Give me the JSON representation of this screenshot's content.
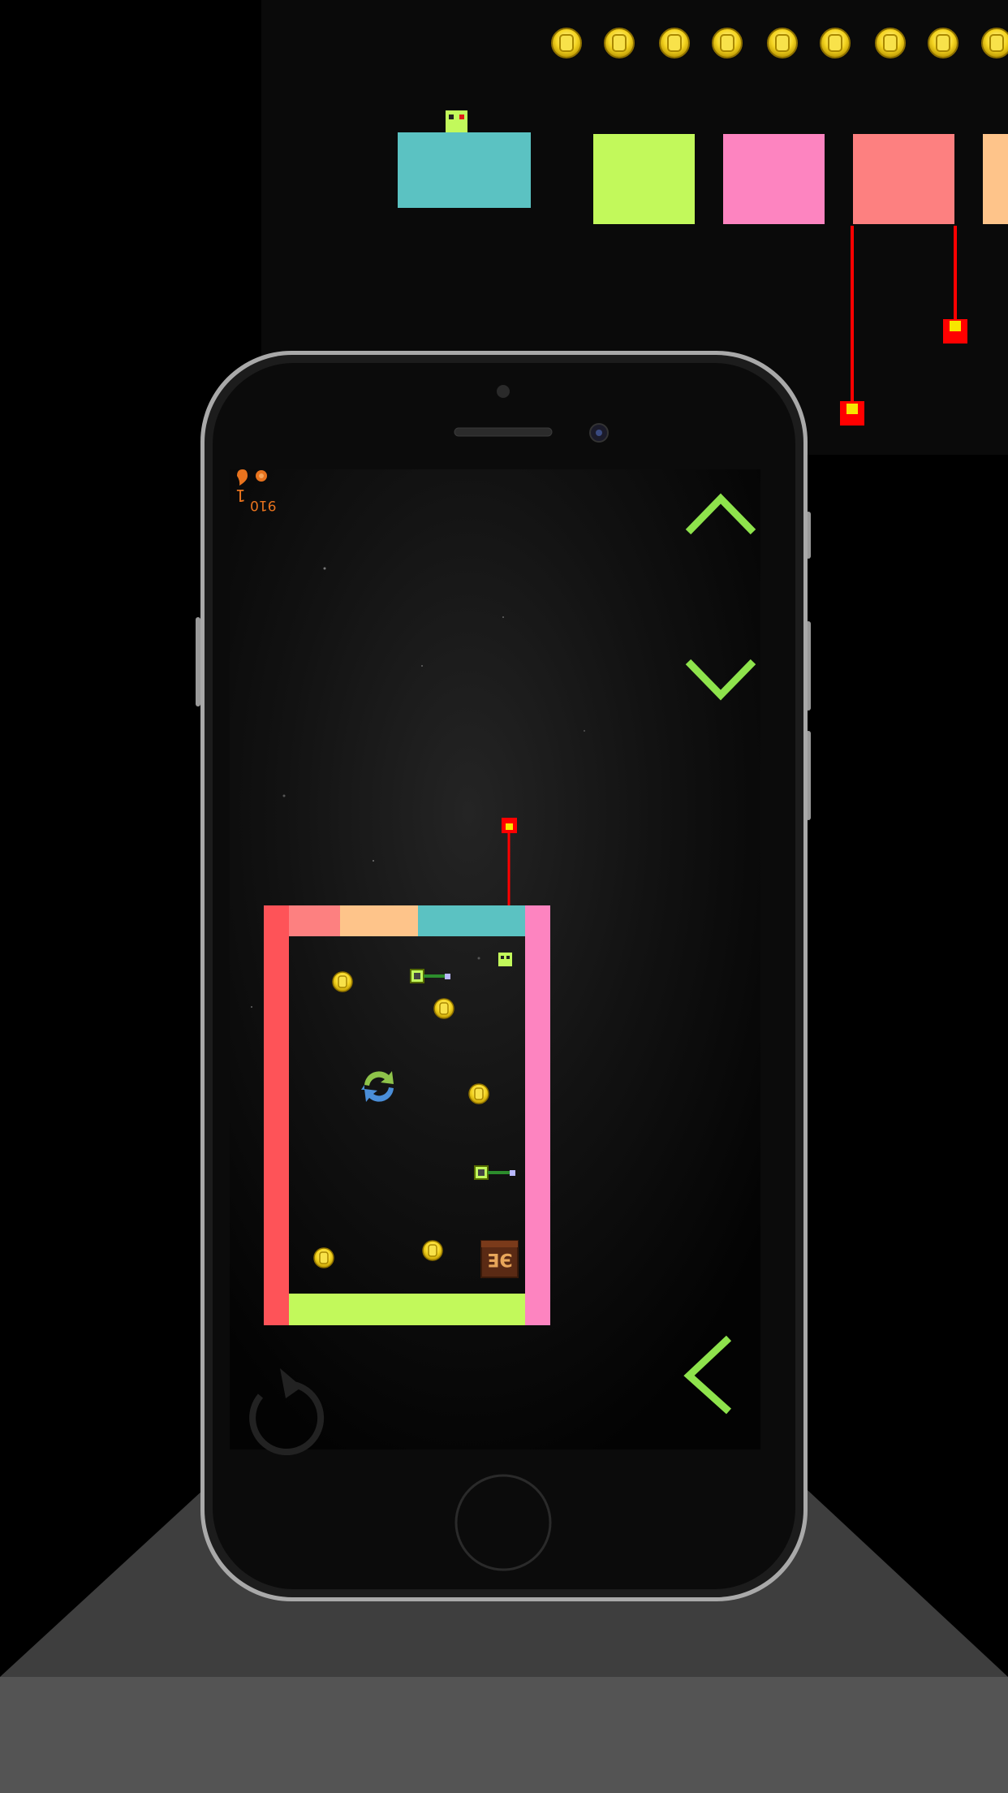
{
  "hud": {
    "level_number": "1",
    "coin_score": "910"
  },
  "game": {
    "top_coin_count": 9,
    "coin_labels_hidden": true
  },
  "exit": {
    "glyph": "ЭE"
  },
  "controls": {
    "up": "up-chevron",
    "down": "down-chevron",
    "back": "left-chevron",
    "restart": "restart-icon"
  },
  "colors": {
    "accent_green": "#8ee34c",
    "block_cyan": "#5bc2c2",
    "block_lime": "#c2f95b",
    "block_pink": "#fd84c0",
    "block_salmon": "#fd8080",
    "block_peach": "#fec48a",
    "wall_red": "#fe5358",
    "laser_red": "#ff0000",
    "coin_gold": "#f5d521",
    "hud_orange": "#e8731e"
  }
}
